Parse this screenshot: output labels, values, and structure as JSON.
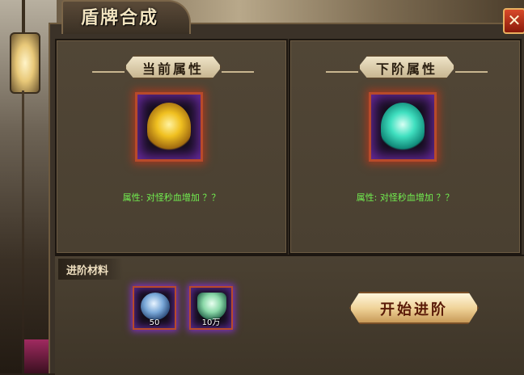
{
  "window": {
    "title": "盾牌合成",
    "close_label": "✕"
  },
  "current": {
    "header": "当前属性",
    "attribute": "属性: 对怪秒血增加 ？？",
    "item_icon": "gold-shield-icon"
  },
  "next": {
    "header": "下阶属性",
    "attribute": "属性: 对怪秒血增加 ？？",
    "item_icon": "teal-shield-icon"
  },
  "materials": {
    "header": "进阶材料",
    "items": [
      {
        "icon": "blue-orb-icon",
        "count": "50"
      },
      {
        "icon": "crystal-cluster-icon",
        "count": "10万"
      }
    ]
  },
  "actions": {
    "start_label": "开始进阶"
  },
  "colors": {
    "attribute_text": "#72f050",
    "accent_gold": "#f0c020",
    "accent_teal": "#40e0c0"
  }
}
